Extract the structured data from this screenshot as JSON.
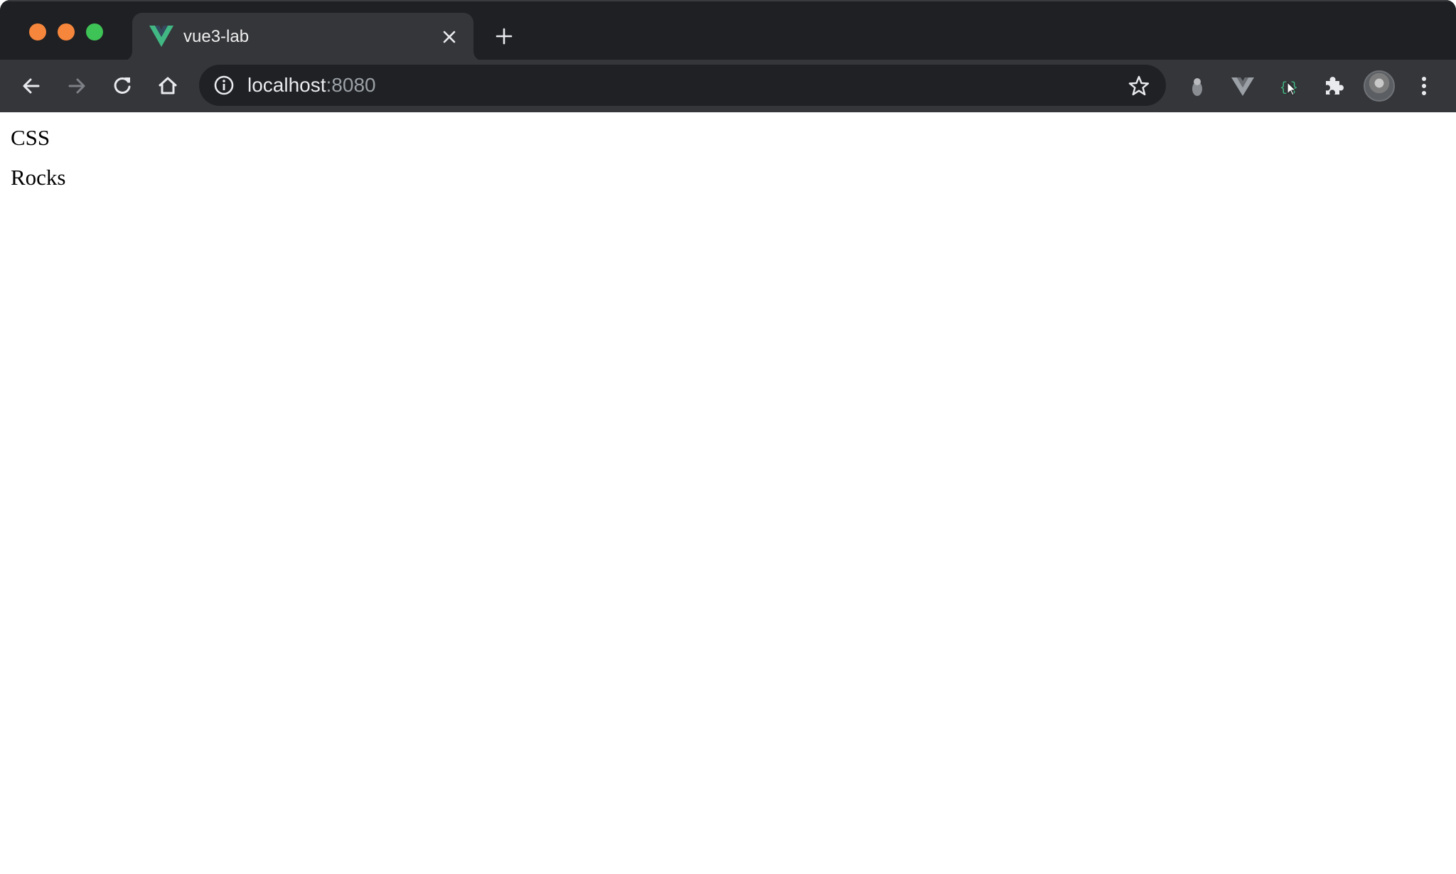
{
  "window": {
    "traffic_lights": {
      "close_color": "#f5863c",
      "minimize_color": "#f5863c",
      "maximize_color": "#3ec356"
    }
  },
  "tab": {
    "title": "vue3-lab",
    "favicon": "vue-logo-icon",
    "close_icon": "close-icon"
  },
  "new_tab_icon": "plus-icon",
  "toolbar": {
    "back_icon": "arrow-left-icon",
    "forward_icon": "arrow-right-icon",
    "forward_enabled": false,
    "reload_icon": "reload-icon",
    "home_icon": "home-icon"
  },
  "omnibox": {
    "info_icon": "info-icon",
    "host": "localhost",
    "port": ":8080",
    "bookmark_icon": "star-icon"
  },
  "extensions": [
    {
      "name": "extension-1",
      "icon": "owl-extension-icon"
    },
    {
      "name": "vue-devtools",
      "icon": "vue-devtools-icon"
    },
    {
      "name": "extension-3",
      "icon": "code-cursor-icon"
    },
    {
      "name": "extensions-menu",
      "icon": "puzzle-icon"
    }
  ],
  "profile_icon": "avatar",
  "menu_icon": "kebab-menu-icon",
  "page": {
    "lines": [
      "CSS",
      "Rocks"
    ]
  },
  "colors": {
    "tabstrip_bg": "#1f2023",
    "toolbar_bg": "#35363a",
    "omnibox_bg": "#202124",
    "vue_green": "#41b883",
    "vue_dark": "#35495e"
  }
}
